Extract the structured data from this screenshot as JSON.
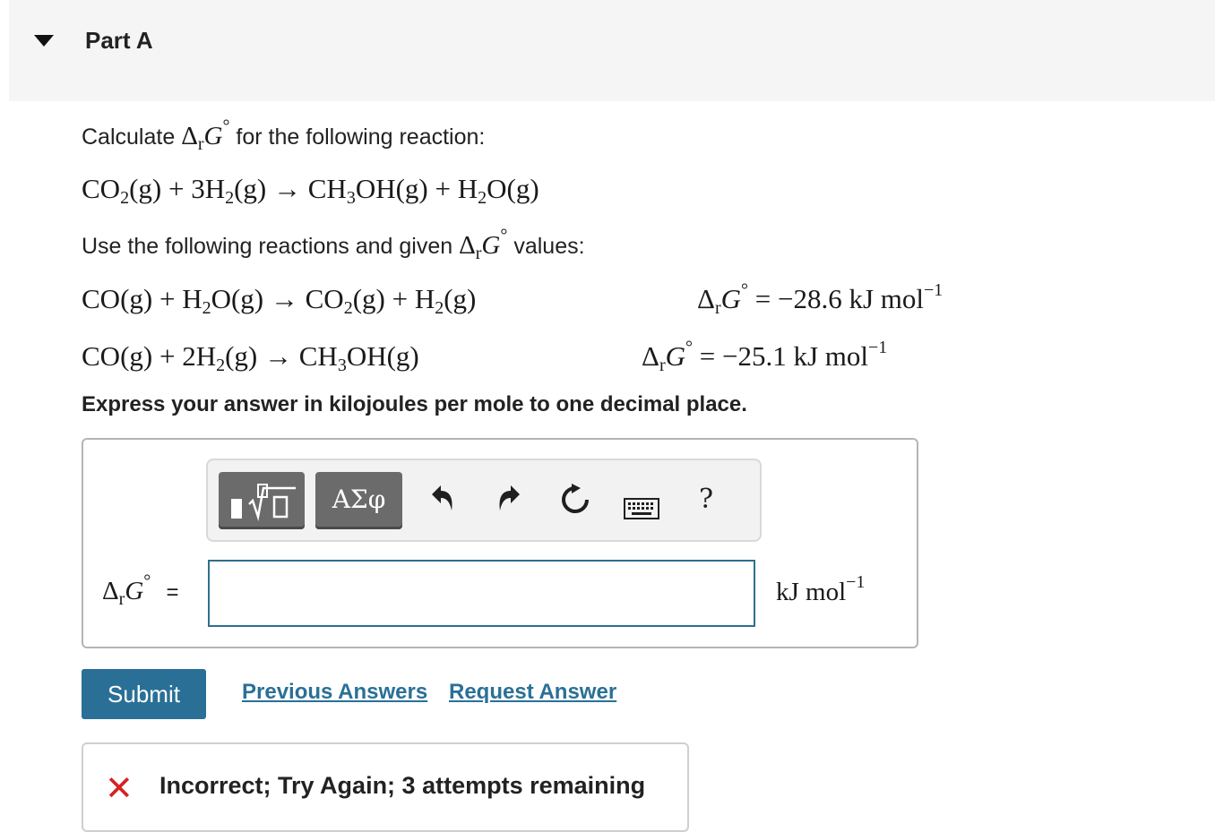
{
  "part": {
    "title": "Part A"
  },
  "prompt": {
    "calc_prefix": "Calculate",
    "calc_suffix": "for the following reaction:",
    "use_prefix": "Use the following reactions and given",
    "use_suffix": "values:",
    "instruction": "Express your answer in kilojoules per mole to one decimal place."
  },
  "symbols": {
    "delta": "Δ",
    "r": "r",
    "G": "G",
    "degree": "°"
  },
  "reactions": {
    "target": {
      "r1": "CO",
      "r1_sub": "2",
      "r1_state": "(g) + 3H",
      "r2_sub": "2",
      "r2_state": "(g) → CH",
      "p1_sub": "3",
      "p1_rest": "OH(g) + H",
      "p2_sub": "2",
      "p2_rest": "O(g)"
    },
    "given1": {
      "a": "CO(g) + H",
      "a_sub": "2",
      "b": "O(g) → CO",
      "b_sub": "2",
      "c": "(g) + H",
      "c_sub": "2",
      "d": "(g)",
      "value": "= −28.6 kJ mol",
      "exp": "−1"
    },
    "given2": {
      "a": "CO(g) + 2H",
      "a_sub": "2",
      "b": "(g) →  CH",
      "b_sub": "3",
      "c": "OH(g)",
      "value": "= −25.1 kJ mol",
      "exp": "−1"
    }
  },
  "toolbar": {
    "greek_label": "ΑΣφ",
    "help_label": "?",
    "icons": [
      "templates-icon",
      "greek-icon",
      "undo-icon",
      "redo-icon",
      "reset-icon",
      "keyboard-icon",
      "help-icon"
    ]
  },
  "answer": {
    "label_eq": "=",
    "value": "",
    "unit": "kJ mol",
    "unit_exp": "−1"
  },
  "actions": {
    "submit": "Submit",
    "previous": "Previous Answers",
    "request": "Request Answer"
  },
  "feedback": {
    "icon": "x-icon",
    "text": "Incorrect; Try Again; 3 attempts remaining",
    "color": "#d62222"
  },
  "colors": {
    "accent": "#2a7096",
    "header_bg": "#f5f5f5"
  }
}
